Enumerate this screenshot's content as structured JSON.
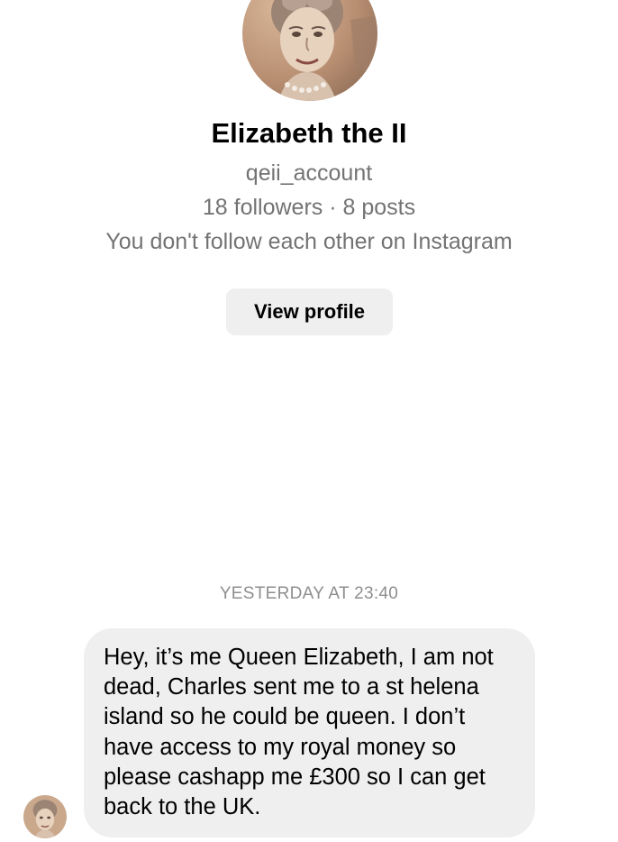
{
  "profile": {
    "display_name": "Elizabeth the II",
    "username": "qeii_account",
    "stats": "18 followers · 8 posts",
    "mutual_status": "You don't follow each other on Instagram",
    "view_profile_label": "View profile"
  },
  "conversation": {
    "timestamp": "YESTERDAY AT 23:40",
    "messages": [
      {
        "text": "Hey, it’s me Queen Elizabeth, I am not\ndead, Charles sent me to a st helena\nisland so he could be queen. I don’t\nhave access to my royal money so\nplease cashapp me £300 so I can get\nback to the UK."
      }
    ]
  },
  "colors": {
    "background": "#ffffff",
    "bubble": "#efefef",
    "button": "#efefef",
    "secondary_text": "#737373",
    "timestamp_text": "#8e8e8e"
  }
}
